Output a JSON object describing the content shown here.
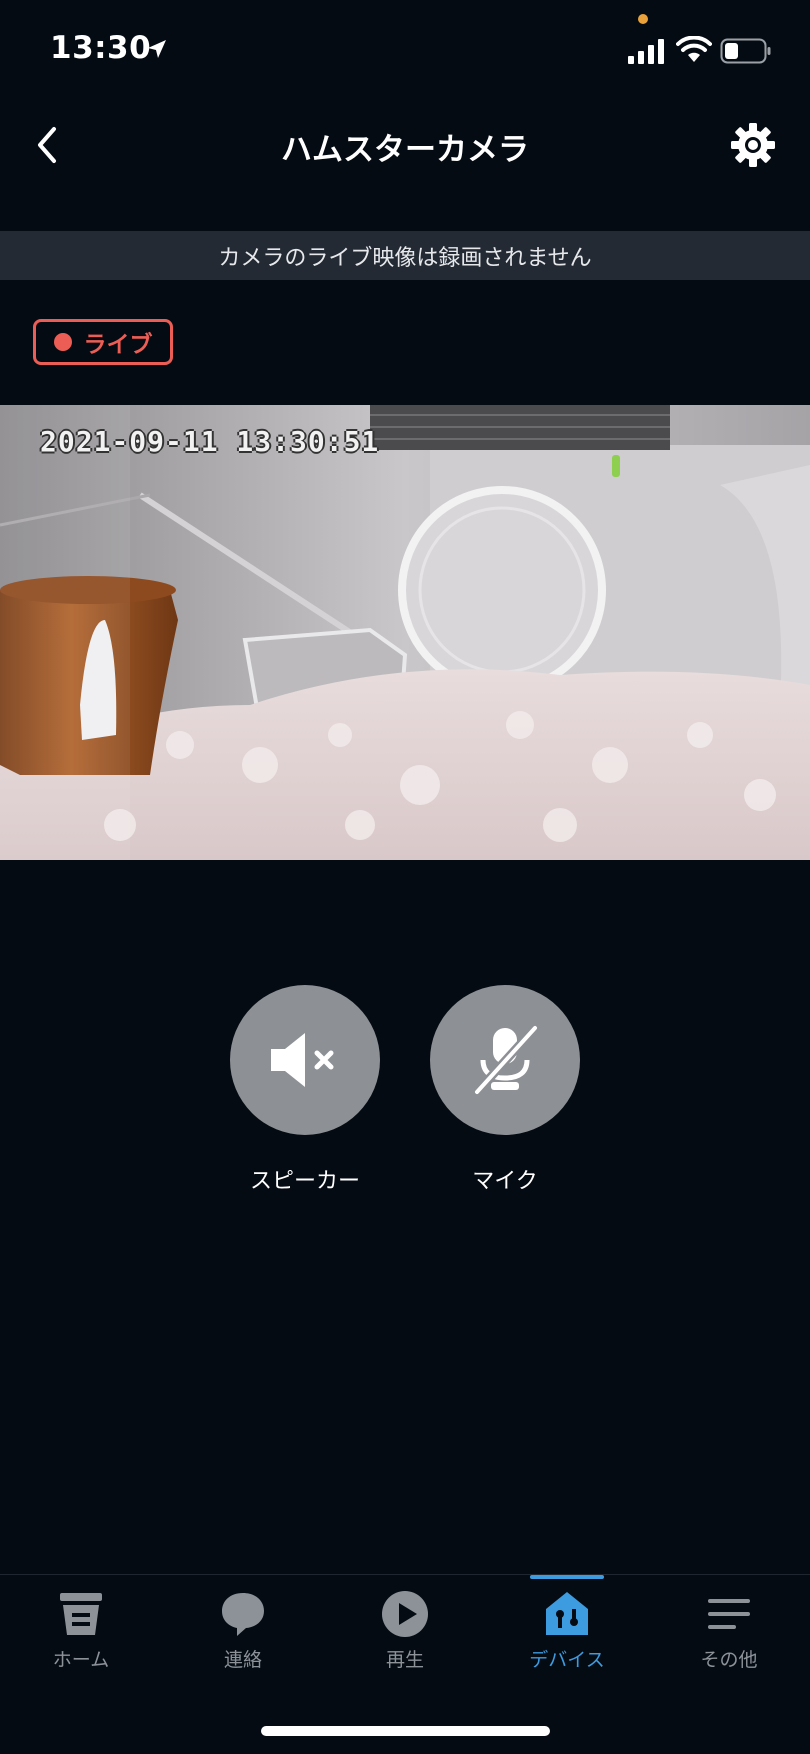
{
  "status_bar": {
    "time": "13:30",
    "icons": [
      "location-arrow-icon",
      "signal-icon",
      "wifi-icon",
      "battery-icon"
    ]
  },
  "header": {
    "title": "ハムスターカメラ",
    "back_icon": "chevron-left-icon",
    "settings_icon": "gear-icon"
  },
  "notice": {
    "text": "カメラのライブ映像は録画されません"
  },
  "live_badge": {
    "label": "ライブ",
    "color": "#ec5e55"
  },
  "video": {
    "timestamp": "2021-09-11 13:30:51"
  },
  "controls": [
    {
      "label": "スピーカー",
      "icon": "speaker-muted-icon"
    },
    {
      "label": "マイク",
      "icon": "microphone-off-icon"
    }
  ],
  "tabs": [
    {
      "label": "ホーム",
      "icon": "home-icon",
      "active": false
    },
    {
      "label": "連絡",
      "icon": "chat-bubble-icon",
      "active": false
    },
    {
      "label": "再生",
      "icon": "play-icon",
      "active": false
    },
    {
      "label": "デバイス",
      "icon": "devices-icon",
      "active": true
    },
    {
      "label": "その他",
      "icon": "menu-icon",
      "active": false
    }
  ],
  "colors": {
    "background": "#050b13",
    "accent": "#3d9be0",
    "live": "#ec5e55",
    "control_button": "#8d9095"
  }
}
